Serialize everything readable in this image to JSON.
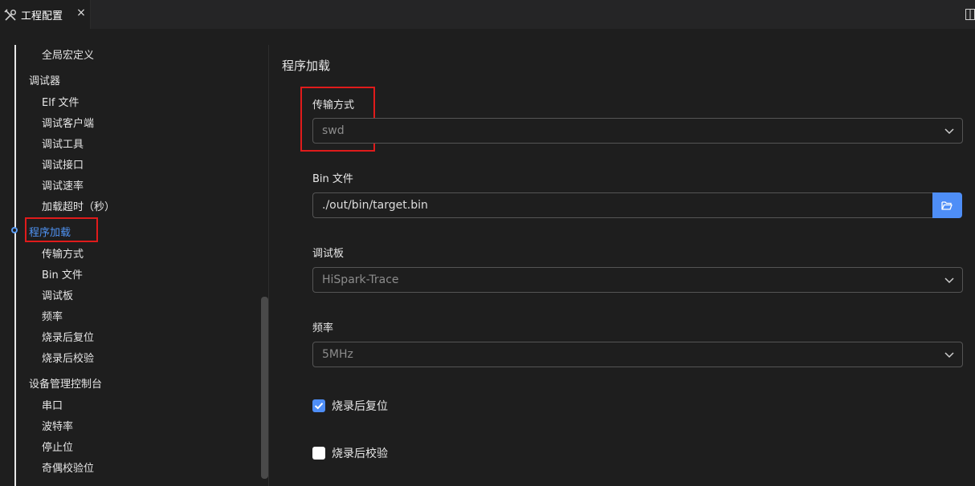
{
  "tab": {
    "title": "工程配置",
    "close": "×",
    "icon": "tools-icon"
  },
  "sidebar": {
    "items": [
      {
        "label": "全局宏定义",
        "level": 2
      },
      {
        "label": "调试器",
        "level": 1
      },
      {
        "label": "Elf 文件",
        "level": 2
      },
      {
        "label": "调试客户端",
        "level": 2
      },
      {
        "label": "调试工具",
        "level": 2
      },
      {
        "label": "调试接口",
        "level": 2
      },
      {
        "label": "调试速率",
        "level": 2
      },
      {
        "label": "加载超时（秒）",
        "level": 2
      },
      {
        "label": "程序加载",
        "level": 1,
        "active": true
      },
      {
        "label": "传输方式",
        "level": 2
      },
      {
        "label": "Bin 文件",
        "level": 2
      },
      {
        "label": "调试板",
        "level": 2
      },
      {
        "label": "频率",
        "level": 2
      },
      {
        "label": "烧录后复位",
        "level": 2
      },
      {
        "label": "烧录后校验",
        "level": 2
      },
      {
        "label": "设备管理控制台",
        "level": 1
      },
      {
        "label": "串口",
        "level": 2
      },
      {
        "label": "波特率",
        "level": 2
      },
      {
        "label": "停止位",
        "level": 2
      },
      {
        "label": "奇偶校验位",
        "level": 2
      }
    ]
  },
  "main": {
    "section_title": "程序加载",
    "transfer": {
      "label": "传输方式",
      "value": "swd"
    },
    "bin_file": {
      "label": "Bin 文件",
      "value": "./out/bin/target.bin"
    },
    "debug_board": {
      "label": "调试板",
      "value": "HiSpark-Trace"
    },
    "frequency": {
      "label": "频率",
      "value": "5MHz"
    },
    "reset_after_burn": {
      "label": "烧录后复位",
      "checked": true
    },
    "verify_after_burn": {
      "label": "烧录后校验",
      "checked": false
    }
  },
  "colors": {
    "accent": "#4e8ef7",
    "highlight": "#e01b1b",
    "background": "#1e1e1e"
  }
}
